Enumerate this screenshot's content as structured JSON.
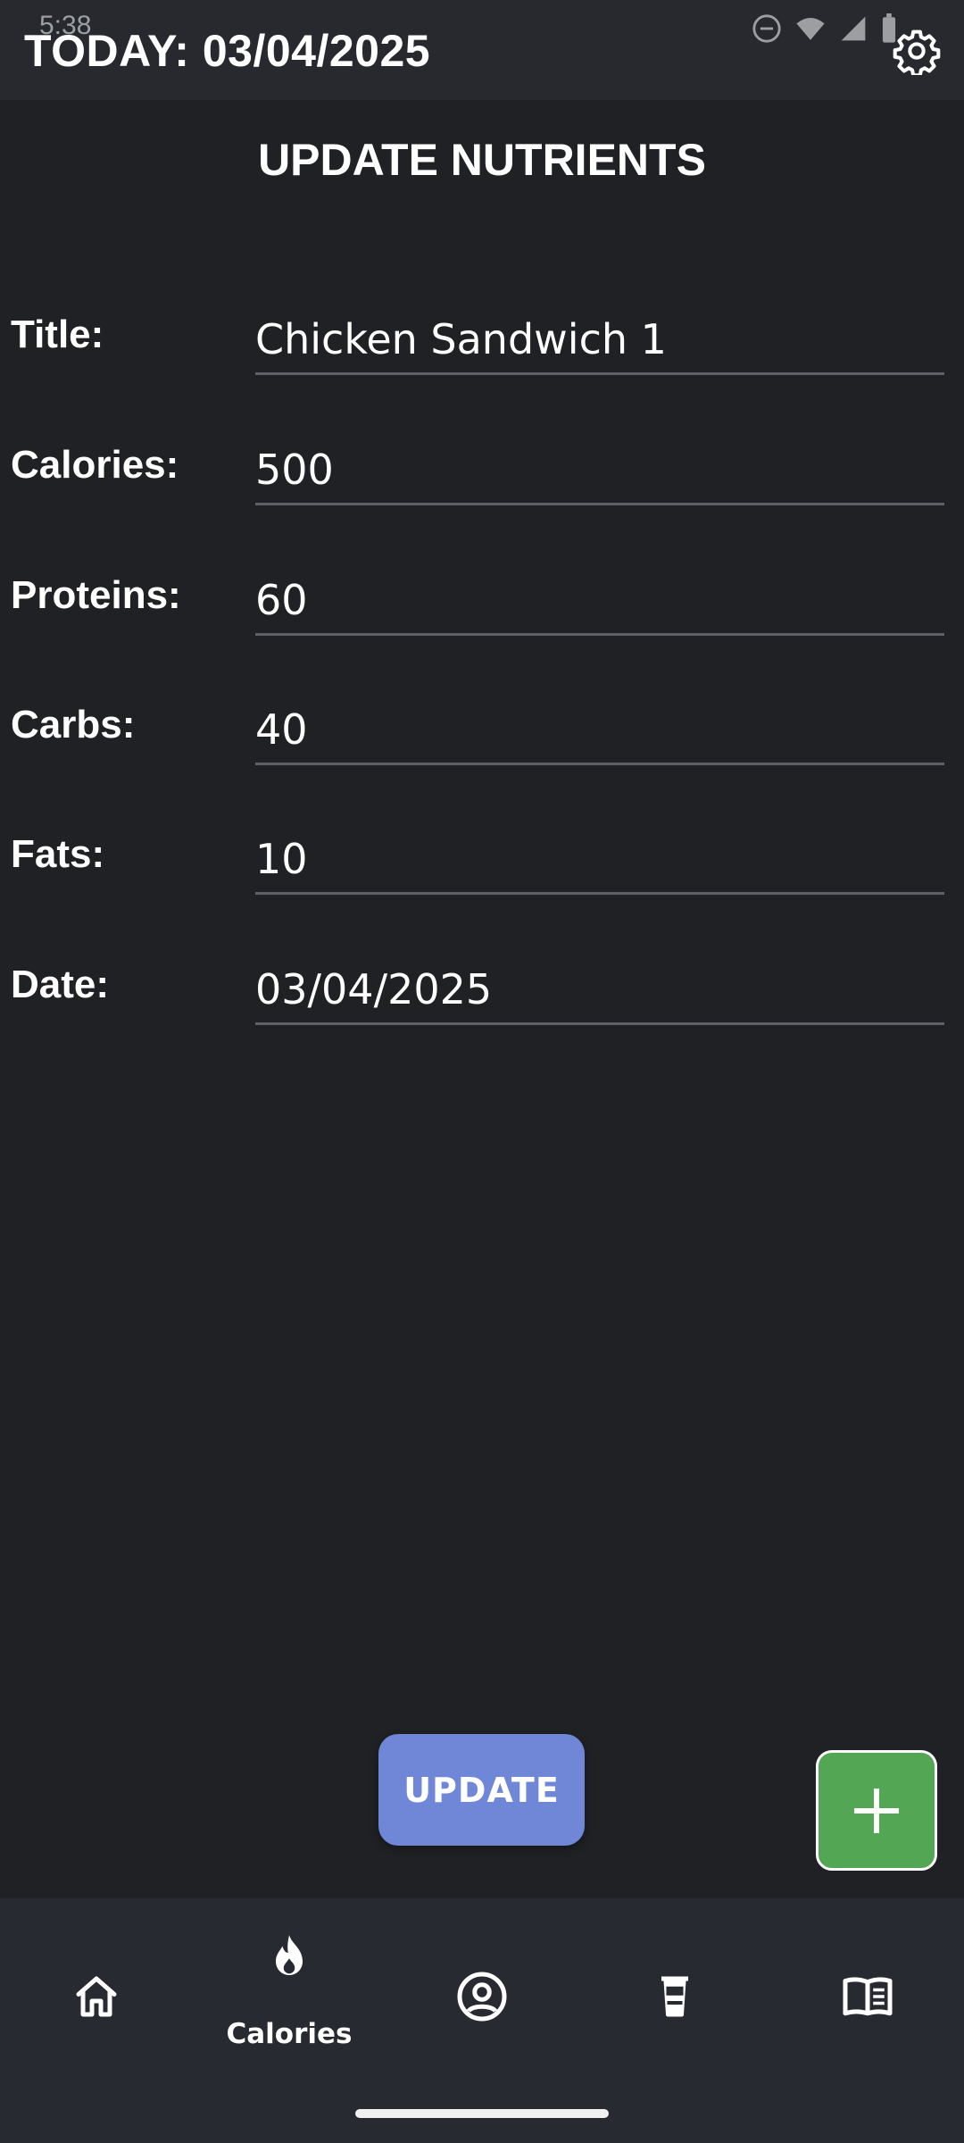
{
  "status_bar": {
    "time": "5:38"
  },
  "header": {
    "title": "TODAY: 03/04/2025"
  },
  "page": {
    "title": "UPDATE NUTRIENTS"
  },
  "form": {
    "fields": [
      {
        "label": "Title:",
        "value": "Chicken Sandwich 1"
      },
      {
        "label": "Calories:",
        "value": "500"
      },
      {
        "label": "Proteins:",
        "value": "60"
      },
      {
        "label": "Carbs:",
        "value": "40"
      },
      {
        "label": "Fats:",
        "value": "10"
      },
      {
        "label": "Date:",
        "value": "03/04/2025"
      }
    ]
  },
  "actions": {
    "update_label": "UPDATE"
  },
  "nav": {
    "items": [
      {
        "icon": "home-icon",
        "label": ""
      },
      {
        "icon": "flame-icon",
        "label": "Calories",
        "active": true
      },
      {
        "icon": "profile-icon",
        "label": ""
      },
      {
        "icon": "drink-icon",
        "label": ""
      },
      {
        "icon": "book-icon",
        "label": ""
      }
    ]
  },
  "colors": {
    "background": "#1f2124",
    "topbar": "#27292e",
    "update_button": "#7086d6",
    "add_button": "#52a654",
    "nav_background": "#272a30"
  }
}
